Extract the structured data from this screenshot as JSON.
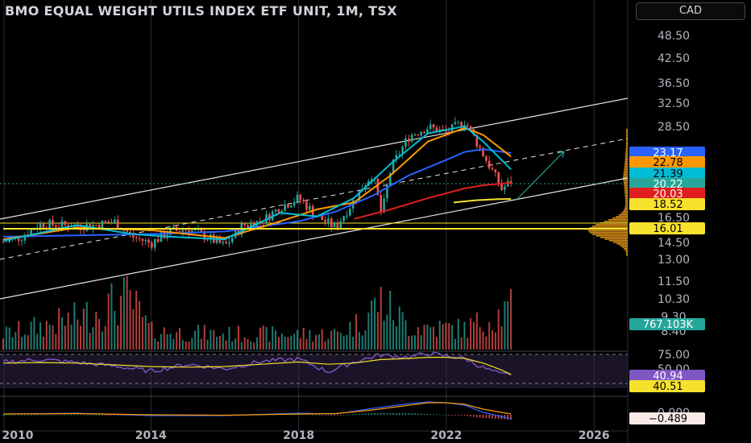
{
  "header": {
    "title": "BMO EQUAL WEIGHT UTILS INDEX ETF UNIT, 1M, TSX",
    "currency": "CAD"
  },
  "price_axis": {
    "ticks": [
      "48.50",
      "42.50",
      "36.50",
      "32.50",
      "28.50",
      "16.50",
      "14.50",
      "13.00",
      "11.50",
      "10.30",
      "9.30",
      "8.40"
    ]
  },
  "time_axis": {
    "labels": [
      {
        "text": "2010",
        "x": 2010.0
      },
      {
        "text": "2014",
        "x": 2014.0
      },
      {
        "text": "2018",
        "x": 2018.0
      },
      {
        "text": "2022",
        "x": 2022.0
      },
      {
        "text": "2026",
        "x": 2026.0
      }
    ]
  },
  "rsi_axis": {
    "ticks": [
      "75.00",
      "50.00"
    ]
  },
  "macd_axis": {
    "ticks": [
      "0.000"
    ]
  },
  "price_badges": [
    {
      "label": "23.17",
      "price": 23.17,
      "color": "#2962ff",
      "text_color": "#ffffff"
    },
    {
      "label": "22.78",
      "price": 22.78,
      "color": "#ff9800",
      "text_color": "#000000"
    },
    {
      "label": "21.39",
      "price": 21.39,
      "color": "#00bcd4",
      "text_color": "#000000"
    },
    {
      "label": "20.22",
      "price": 20.22,
      "color": "#26a69a",
      "text_color": "#ffffff"
    },
    {
      "label": "20.03",
      "price": 20.03,
      "color": "#e01e1e",
      "text_color": "#ffffff"
    },
    {
      "label": "18.52",
      "price": 18.52,
      "color": "#f6e12c",
      "text_color": "#000000"
    },
    {
      "label": "16.01",
      "price": 16.01,
      "color": "#f6e12c",
      "text_color": "#000000"
    }
  ],
  "volume_badge": {
    "label": "767.103K",
    "color": "#26a69a"
  },
  "rsi_badges": [
    {
      "label": "40.94",
      "value": 40.94,
      "color": "#7e57c2",
      "text_color": "#ffffff"
    },
    {
      "label": "40.51",
      "value": 40.51,
      "color": "#f6e12c",
      "text_color": "#000000"
    }
  ],
  "macd_badge": {
    "label": "−0.489",
    "value": -0.489,
    "color": "#fbe9e7",
    "text_color": "#000000"
  },
  "colors": {
    "up": "#26a69a",
    "down": "#ef5350",
    "ma_blue": "#2962ff",
    "ma_orange": "#ff9800",
    "ma_cyan": "#00bcd4",
    "ma_red": "#e01e1e",
    "ma_yellow": "#f6e12c",
    "rsi_line": "#7e57c2",
    "rsi_ma": "#f6e12c",
    "vpvr": "#f6a21a"
  },
  "chart_data": {
    "type": "candlestick",
    "scale": "log",
    "x_unit": "year",
    "xlim": [
      2010.0,
      2027.0
    ],
    "ylim": [
      7.7,
      56.0
    ],
    "price_series": {
      "name": "",
      "x": [
        2010.0,
        2010.5,
        2011.0,
        2011.5,
        2012.0,
        2012.5,
        2013.0,
        2013.5,
        2014.0,
        2014.5,
        2015.0,
        2015.5,
        2016.0,
        2016.5,
        2017.0,
        2017.5,
        2018.0,
        2018.5,
        2019.0,
        2019.5,
        2020.0,
        2020.25,
        2020.5,
        2021.0,
        2021.5,
        2022.0,
        2022.5,
        2022.75,
        2023.0,
        2023.5,
        2023.75
      ],
      "close": [
        15.0,
        15.4,
        16.4,
        16.3,
        16.2,
        16.3,
        16.6,
        15.4,
        14.9,
        15.8,
        16.0,
        15.4,
        14.7,
        16.3,
        16.6,
        17.8,
        18.6,
        17.0,
        16.1,
        18.4,
        21.0,
        17.0,
        21.5,
        25.2,
        26.3,
        25.6,
        27.1,
        25.0,
        23.0,
        19.4,
        20.2
      ]
    },
    "overlays": [
      {
        "name": "",
        "color": "#2962ff",
        "x": [
          2010.0,
          2014.0,
          2016.0,
          2018.0,
          2019.0,
          2020.0,
          2021.0,
          2022.0,
          2022.5,
          2023.0,
          2023.75
        ],
        "y": [
          15.4,
          15.6,
          15.8,
          16.6,
          17.4,
          18.8,
          20.8,
          22.4,
          23.3,
          23.6,
          23.17
        ]
      },
      {
        "name": "",
        "color": "#ff9800",
        "x": [
          2010.0,
          2012.0,
          2014.0,
          2016.0,
          2017.5,
          2018.5,
          2019.5,
          2020.5,
          2021.5,
          2022.5,
          2023.0,
          2023.75
        ],
        "y": [
          15.2,
          16.1,
          15.9,
          15.3,
          16.6,
          17.6,
          18.2,
          20.8,
          24.5,
          26.2,
          25.3,
          22.78
        ]
      },
      {
        "name": "",
        "color": "#00bcd4",
        "x": [
          2010.0,
          2012.0,
          2013.5,
          2014.5,
          2016.0,
          2017.5,
          2018.5,
          2019.5,
          2020.5,
          2021.5,
          2022.5,
          2023.0,
          2023.75
        ],
        "y": [
          15.1,
          16.3,
          15.6,
          15.4,
          15.2,
          17.3,
          17.0,
          18.6,
          22.0,
          25.5,
          26.4,
          24.5,
          21.39
        ]
      },
      {
        "name": "",
        "color": "#e01e1e",
        "x": [
          2019.5,
          2020.5,
          2021.5,
          2022.5,
          2023.0,
          2023.75
        ],
        "y": [
          16.8,
          17.6,
          18.6,
          19.5,
          19.8,
          20.03
        ]
      },
      {
        "name": "",
        "color": "#f6e12c",
        "x": [
          2022.2,
          2022.8,
          2023.4,
          2023.75
        ],
        "y": [
          18.2,
          18.4,
          18.5,
          18.52
        ]
      },
      {
        "name": "",
        "color": "#f6e12c",
        "x": [
          2010.0,
          2026.9
        ],
        "y": [
          16.01,
          16.01
        ]
      }
    ],
    "volume": {
      "x": [
        2010.0,
        2012.0,
        2013.4,
        2014.0,
        2016.0,
        2019.0,
        2019.6,
        2020.2,
        2021.0,
        2022.5,
        2023.75
      ],
      "values": [
        0.3,
        0.6,
        1.0,
        0.35,
        0.3,
        0.3,
        0.5,
        0.95,
        0.45,
        0.4,
        0.77
      ]
    },
    "rsi": {
      "x": [
        2010.0,
        2011.0,
        2012.0,
        2013.0,
        2014.0,
        2015.0,
        2016.0,
        2017.0,
        2018.0,
        2018.8,
        2019.5,
        2020.2,
        2021.0,
        2021.5,
        2022.0,
        2022.5,
        2023.0,
        2023.5,
        2023.75
      ],
      "values": [
        62,
        66,
        61,
        55,
        46,
        58,
        50,
        63,
        67,
        45,
        62,
        74,
        70,
        77,
        72,
        68,
        52,
        40,
        40.94
      ],
      "ma_values": [
        60,
        61,
        60,
        57,
        54,
        53,
        54,
        58,
        62,
        58,
        60,
        66,
        68,
        70,
        70,
        68,
        60,
        48,
        40.51
      ]
    },
    "macd": {
      "x": [
        2010.0,
        2012.0,
        2014.0,
        2016.0,
        2018.0,
        2019.0,
        2020.0,
        2021.0,
        2021.5,
        2022.0,
        2022.5,
        2023.0,
        2023.75
      ],
      "macd": [
        0.1,
        0.2,
        -0.1,
        -0.1,
        0.2,
        0.1,
        0.8,
        1.4,
        1.6,
        1.5,
        1.2,
        0.3,
        -0.489
      ],
      "signal": [
        0.1,
        0.15,
        0.0,
        -0.05,
        0.1,
        0.15,
        0.6,
        1.2,
        1.5,
        1.5,
        1.3,
        0.7,
        0.1
      ]
    }
  }
}
